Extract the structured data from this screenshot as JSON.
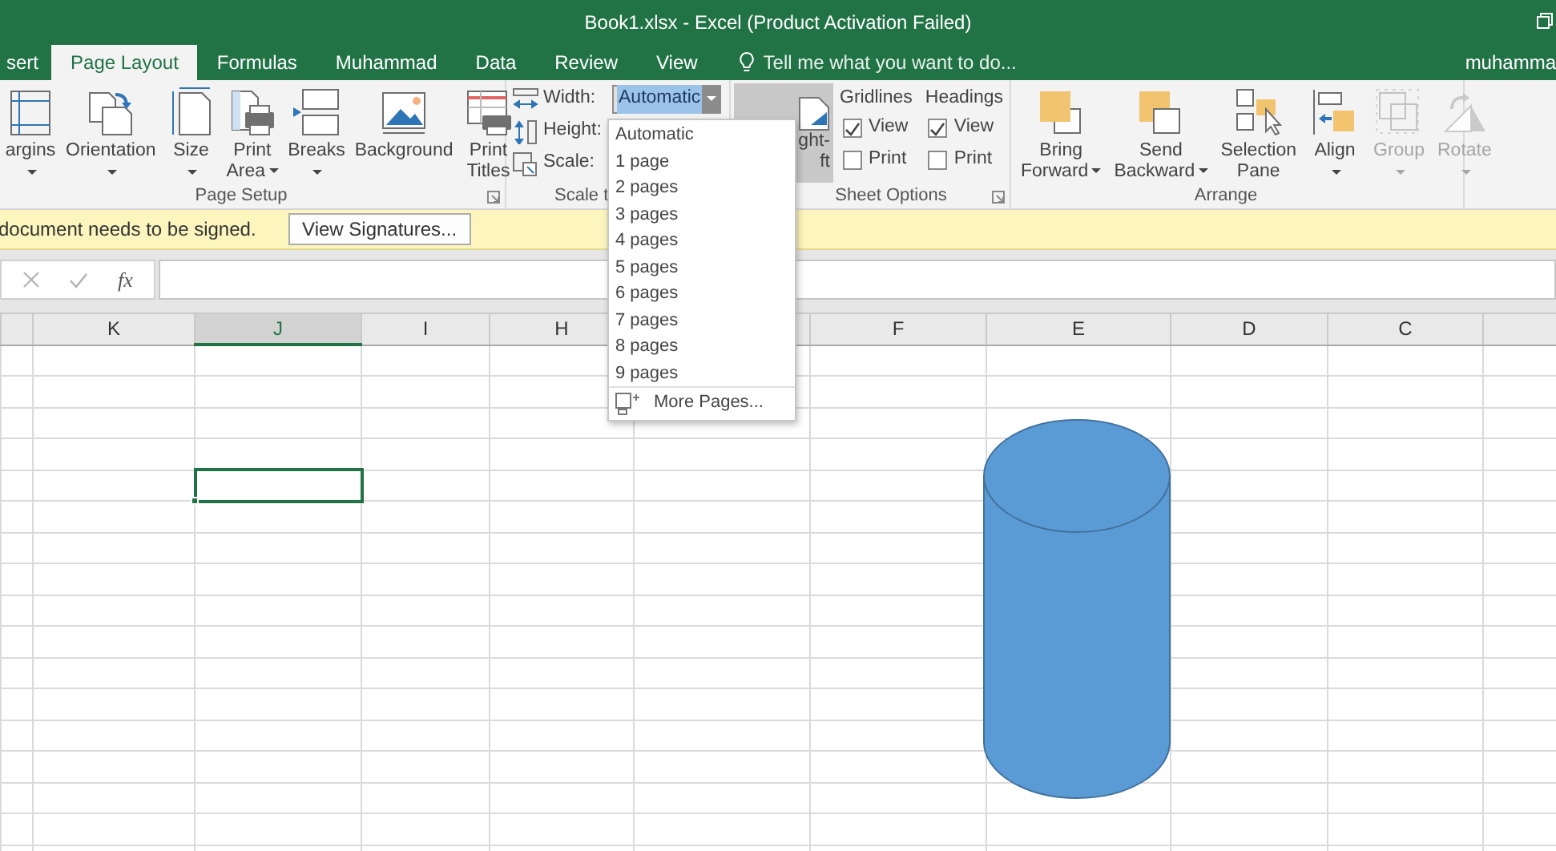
{
  "window": {
    "title": "Book1.xlsx - Excel (Product Activation Failed)"
  },
  "tabs": [
    {
      "label": "sert",
      "selected": false
    },
    {
      "label": "Page Layout",
      "selected": true
    },
    {
      "label": "Formulas",
      "selected": false
    },
    {
      "label": "Muhammad",
      "selected": false
    },
    {
      "label": "Data",
      "selected": false
    },
    {
      "label": "Review",
      "selected": false
    },
    {
      "label": "View",
      "selected": false
    }
  ],
  "tell_me": {
    "placeholder": "Tell me what you want to do..."
  },
  "account": "muhamma",
  "page_setup": {
    "label": "Page Setup",
    "buttons": [
      {
        "kind": "margins",
        "lines": [
          "argins"
        ],
        "dropdown": true,
        "disabled": false
      },
      {
        "kind": "orientation",
        "lines": [
          "Orientation"
        ],
        "dropdown": true,
        "disabled": false
      },
      {
        "kind": "size",
        "lines": [
          "Size"
        ],
        "dropdown": true,
        "disabled": false
      },
      {
        "kind": "print_area",
        "lines": [
          "Print",
          "Area"
        ],
        "dropdown": true,
        "disabled": false
      },
      {
        "kind": "breaks",
        "lines": [
          "Breaks"
        ],
        "dropdown": true,
        "disabled": false
      },
      {
        "kind": "background",
        "lines": [
          "Background"
        ],
        "dropdown": false,
        "disabled": false
      },
      {
        "kind": "print_titles",
        "lines": [
          "Print",
          "Titles"
        ],
        "dropdown": false,
        "disabled": false
      }
    ]
  },
  "scale_to_fit": {
    "label": "Scale t",
    "rows": [
      {
        "kind": "combo",
        "label": "Width:",
        "value": "Automatic"
      },
      {
        "kind": "plain",
        "label": "Height:"
      },
      {
        "kind": "plain",
        "label": "Scale:"
      }
    ]
  },
  "rtl_button": {
    "lines": [
      "ght-",
      "ft"
    ]
  },
  "sheet_options": {
    "label": "Sheet Options",
    "columns": [
      {
        "title": "Gridlines",
        "options": [
          {
            "label": "View",
            "checked": true
          },
          {
            "label": "Print",
            "checked": false
          }
        ]
      },
      {
        "title": "Headings",
        "options": [
          {
            "label": "View",
            "checked": true
          },
          {
            "label": "Print",
            "checked": false
          }
        ]
      }
    ]
  },
  "arrange": {
    "label": "Arrange",
    "buttons": [
      {
        "kind": "bring_forward",
        "lines": [
          "Bring",
          "Forward"
        ],
        "dropdown": true,
        "disabled": false
      },
      {
        "kind": "send_backward",
        "lines": [
          "Send",
          "Backward"
        ],
        "dropdown": true,
        "disabled": false
      },
      {
        "kind": "selection_pane",
        "lines": [
          "Selection",
          "Pane"
        ],
        "dropdown": false,
        "disabled": false
      },
      {
        "kind": "align",
        "lines": [
          "Align"
        ],
        "dropdown": true,
        "disabled": false
      },
      {
        "kind": "group",
        "lines": [
          "Group"
        ],
        "dropdown": true,
        "disabled": true
      },
      {
        "kind": "rotate",
        "lines": [
          "Rotate"
        ],
        "dropdown": true,
        "disabled": true
      }
    ]
  },
  "width_menu": {
    "items": [
      "Automatic",
      "1 page",
      "2 pages",
      "3 pages",
      "4 pages",
      "5 pages",
      "6 pages",
      "7 pages",
      "8 pages",
      "9 pages"
    ],
    "footer": "More Pages..."
  },
  "message_bar": {
    "text": "document needs to be signed.",
    "button": "View Signatures..."
  },
  "formula_bar": {
    "function_label": "fx"
  },
  "columns": [
    {
      "kind": "blank",
      "selected": false
    },
    {
      "kind": "letter",
      "label": "K",
      "selected": false
    },
    {
      "kind": "letter",
      "label": "J",
      "selected": true
    },
    {
      "kind": "letter",
      "label": "I",
      "selected": false
    },
    {
      "kind": "letter",
      "label": "H",
      "selected": false
    },
    {
      "kind": "blank",
      "selected": false
    },
    {
      "kind": "letter",
      "label": "F",
      "selected": false
    },
    {
      "kind": "letter",
      "label": "E",
      "selected": false
    },
    {
      "kind": "letter",
      "label": "D",
      "selected": false
    },
    {
      "kind": "letter",
      "label": "C",
      "selected": false
    },
    {
      "kind": "blank",
      "selected": false
    }
  ],
  "shapes": [
    {
      "kind": "cylinder"
    }
  ]
}
